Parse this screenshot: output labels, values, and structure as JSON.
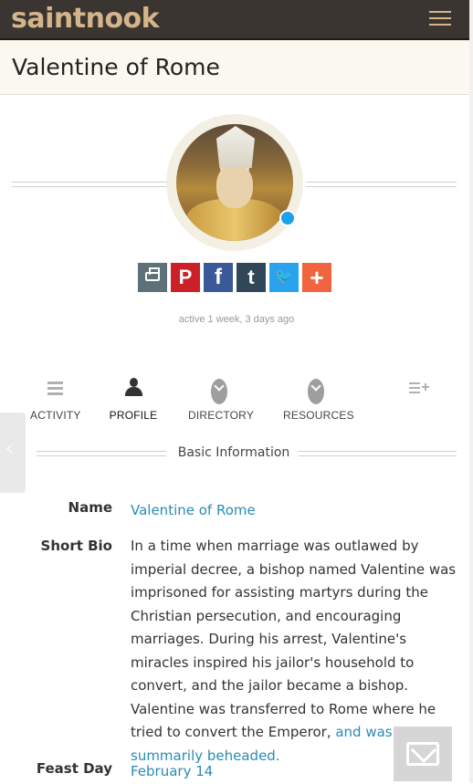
{
  "nav": {
    "logo": "saintnook"
  },
  "page": {
    "title": "Valentine of Rome"
  },
  "profile": {
    "status": "active 1 week, 3 days ago",
    "online_dot_color": "#1da1e8"
  },
  "share": {
    "buttons": [
      {
        "icon": "print-icon",
        "glyph": "",
        "color": "#5f7178"
      },
      {
        "icon": "pinterest-icon",
        "glyph": "P",
        "color": "#cb2027"
      },
      {
        "icon": "facebook-icon",
        "glyph": "f",
        "color": "#3b5998"
      },
      {
        "icon": "tumblr-icon",
        "glyph": "t",
        "color": "#32465a"
      },
      {
        "icon": "twitter-icon",
        "glyph": "🐦",
        "color": "#2aa3ef"
      },
      {
        "icon": "more-share-icon",
        "glyph": "+",
        "color": "#f0643f"
      }
    ]
  },
  "tabs": [
    {
      "label": "ACTIVITY",
      "icon": "list-icon",
      "active": false
    },
    {
      "label": "PROFILE",
      "icon": "person-icon",
      "active": true
    },
    {
      "label": "DIRECTORY",
      "icon": "chevron-down-circle-icon",
      "active": false
    },
    {
      "label": "RESOURCES",
      "icon": "chevron-down-circle-icon",
      "active": false
    },
    {
      "label": "",
      "icon": "playlist-add-icon",
      "active": false
    }
  ],
  "section": {
    "title": "Basic Information"
  },
  "fields": {
    "name": {
      "label": "Name",
      "value": "Valentine of Rome"
    },
    "bio": {
      "label": "Short Bio",
      "text": "In a time when marriage was outlawed by imperial decree, a bishop named Valentine was imprisoned for assisting martyrs during the Christian persecution, and encouraging marriages. During his arrest, Valentine's miracles inspired his jailor's household to convert, and the jailor became a bishop. Valentine was transferred to Rome where he tried to convert the Emperor, ",
      "link_text": "and was summarily beheaded."
    },
    "feast": {
      "label": "Feast Day",
      "value": "February 14"
    }
  },
  "colors": {
    "nav_bg": "#3a3530",
    "logo": "#d4b48a",
    "title_band": "#fbf8ef",
    "link": "#2a8bb5"
  }
}
